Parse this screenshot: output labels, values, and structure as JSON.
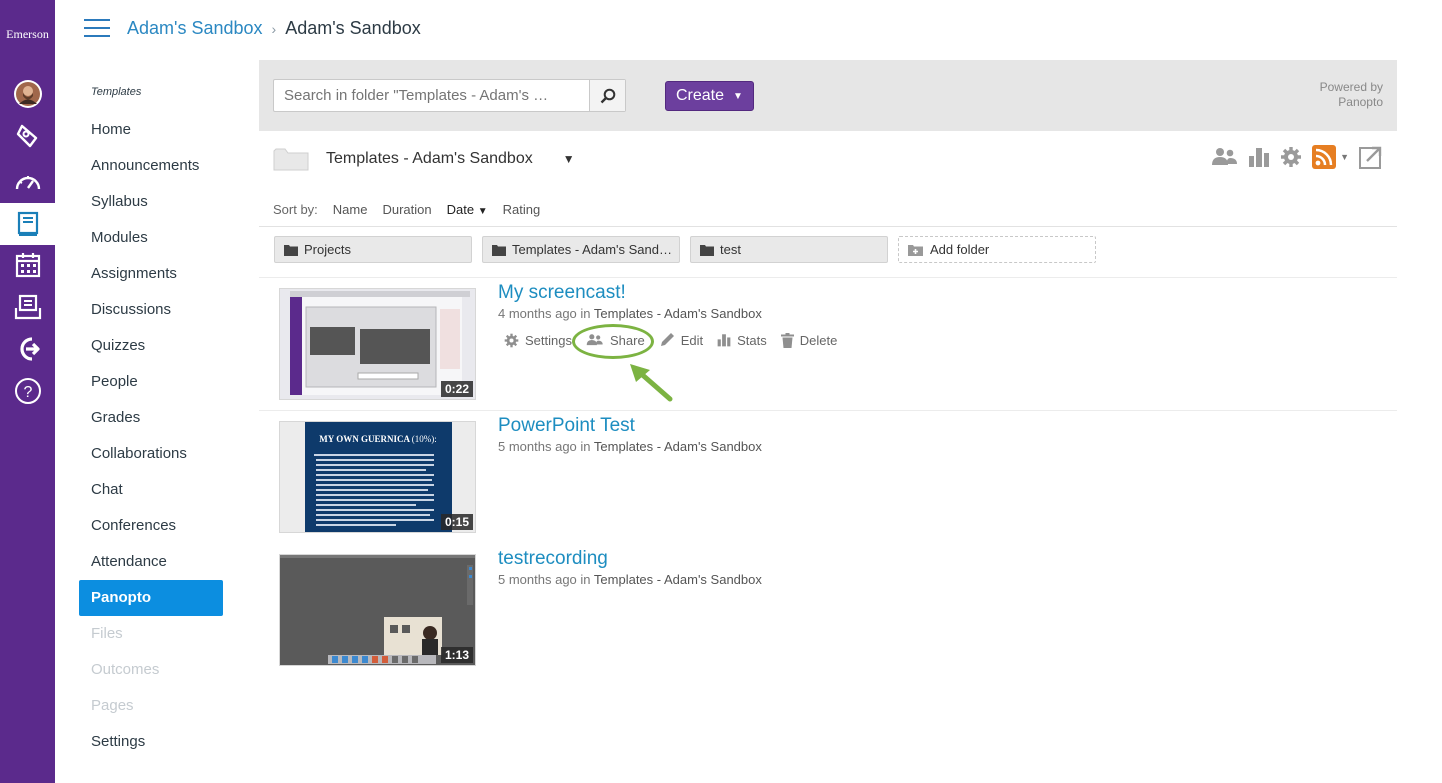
{
  "global_nav": {
    "brand": "Emerson",
    "items": [
      {
        "name": "account",
        "icon": "avatar"
      },
      {
        "name": "admin",
        "icon": "shield-icon"
      },
      {
        "name": "dashboard",
        "icon": "dashboard-icon"
      },
      {
        "name": "courses",
        "icon": "book-icon",
        "active": true
      },
      {
        "name": "calendar",
        "icon": "calendar-icon"
      },
      {
        "name": "inbox",
        "icon": "inbox-icon"
      },
      {
        "name": "commons",
        "icon": "commons-icon"
      },
      {
        "name": "help",
        "icon": "help-icon"
      }
    ]
  },
  "header": {
    "breadcrumb_link": "Adam's Sandbox",
    "breadcrumb_current": "Adam's Sandbox"
  },
  "course_nav": {
    "subtitle": "Templates",
    "items": [
      {
        "label": "Home"
      },
      {
        "label": "Announcements"
      },
      {
        "label": "Syllabus"
      },
      {
        "label": "Modules"
      },
      {
        "label": "Assignments"
      },
      {
        "label": "Discussions"
      },
      {
        "label": "Quizzes"
      },
      {
        "label": "People"
      },
      {
        "label": "Grades"
      },
      {
        "label": "Collaborations"
      },
      {
        "label": "Chat"
      },
      {
        "label": "Conferences"
      },
      {
        "label": "Attendance"
      },
      {
        "label": "Panopto",
        "active": true
      },
      {
        "label": "Files",
        "disabled": true
      },
      {
        "label": "Outcomes",
        "disabled": true
      },
      {
        "label": "Pages",
        "disabled": true
      },
      {
        "label": "Settings"
      }
    ]
  },
  "panopto": {
    "search_placeholder": "Search in folder \"Templates - Adam's …",
    "create_label": "Create",
    "powered_line1": "Powered by",
    "powered_line2": "Panopto",
    "folder_title": "Templates - Adam's Sandbox",
    "sort": {
      "label": "Sort by:",
      "options": [
        "Name",
        "Duration",
        "Date",
        "Rating"
      ],
      "active": "Date"
    },
    "folders": [
      "Projects",
      "Templates - Adam's Sand…",
      "test"
    ],
    "add_folder_label": "Add folder",
    "sessions": [
      {
        "title": "My screencast!",
        "age": "4 months ago in",
        "folder": "Templates - Adam's Sandbox",
        "duration": "0:22",
        "show_actions": true
      },
      {
        "title": "PowerPoint Test",
        "age": "5 months ago in",
        "folder": "Templates - Adam's Sandbox",
        "duration": "0:15"
      },
      {
        "title": "testrecording",
        "age": "5 months ago in",
        "folder": "Templates - Adam's Sandbox",
        "duration": "1:13"
      }
    ],
    "actions": {
      "settings": "Settings",
      "share": "Share",
      "edit": "Edit",
      "stats": "Stats",
      "delete": "Delete"
    },
    "slide_title": "MY OWN GUERNICA",
    "slide_title_suffix": "(10%):",
    "colors": {
      "nav": "#5b2a8c",
      "accent": "#0c8ee0",
      "create": "#6c3f9e",
      "link": "#1d8dc0",
      "highlight": "#7cb342",
      "rss": "#e67e22"
    }
  }
}
